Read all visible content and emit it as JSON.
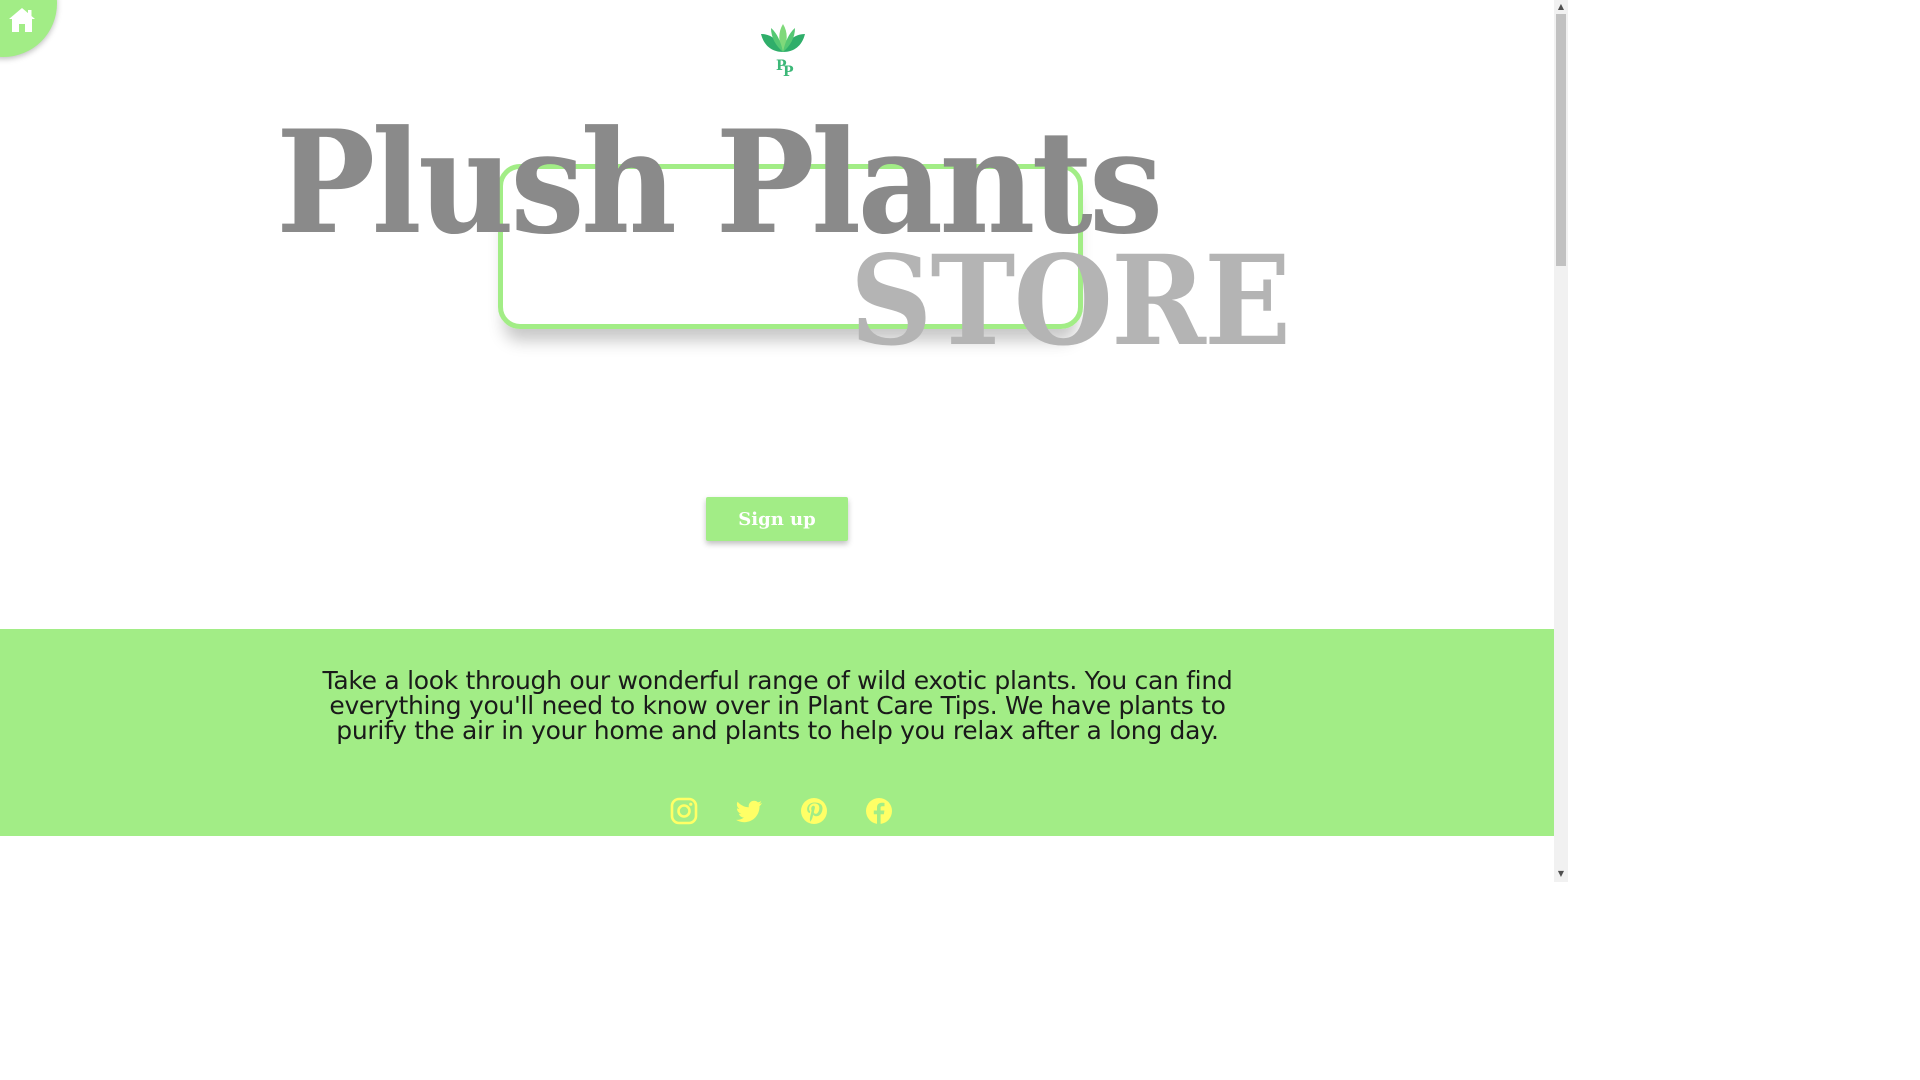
{
  "nav": {
    "home_icon": "home-icon"
  },
  "logo": {
    "icon": "leaf-logo-icon",
    "monogram": "PP",
    "colors": {
      "leaf_dark": "#2fae6a",
      "leaf_light": "#7fd97a",
      "monogram": "#3cb878"
    }
  },
  "hero": {
    "title": "Plush Plants",
    "subtitle": "STORE"
  },
  "cta": {
    "signup_label": "Sign up"
  },
  "intro": {
    "text": "Take a look through our wonderful range of wild exotic plants. You can find everything you'll need to know over in Plant Care Tips. We have plants to purify the air in your home and plants to help you relax after a long day."
  },
  "social": {
    "icons": [
      "instagram-icon",
      "twitter-icon",
      "pinterest-icon",
      "facebook-icon"
    ],
    "icon_color": "#ffff66"
  },
  "colors": {
    "accent": "#a2ed86",
    "title_gray": "#8a8a8a",
    "subtitle_gray": "#b4b4b4"
  }
}
